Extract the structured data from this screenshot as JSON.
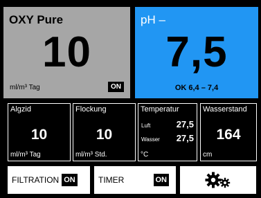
{
  "oxy": {
    "title": "OXY Pure",
    "value": "10",
    "unit": "ml/m³ Tag",
    "status": "ON"
  },
  "ph": {
    "title": "pH –",
    "value": "7,5",
    "status_text": "OK  6,4 – 7,4"
  },
  "algizid": {
    "label": "Algzid",
    "value": "10",
    "unit": "ml/m³ Tag"
  },
  "flockung": {
    "label": "Flockung",
    "value": "10",
    "unit": "ml/m³ Std."
  },
  "temperatur": {
    "label": "Temperatur",
    "luft_label": "Luft",
    "luft_value": "27,5",
    "wasser_label": "Wasser",
    "wasser_value": "27,5",
    "unit": "°C"
  },
  "wasserstand": {
    "label": "Wasserstand",
    "value": "164",
    "unit": "cm"
  },
  "buttons": {
    "filtration_label": "FILTRATION",
    "filtration_state": "ON",
    "timer_label": "TIMER",
    "timer_state": "ON",
    "settings_icon": "gears-icon"
  },
  "colors": {
    "oxy_panel": "#a6a6a6",
    "ph_panel": "#2196f3",
    "background": "#000000"
  }
}
